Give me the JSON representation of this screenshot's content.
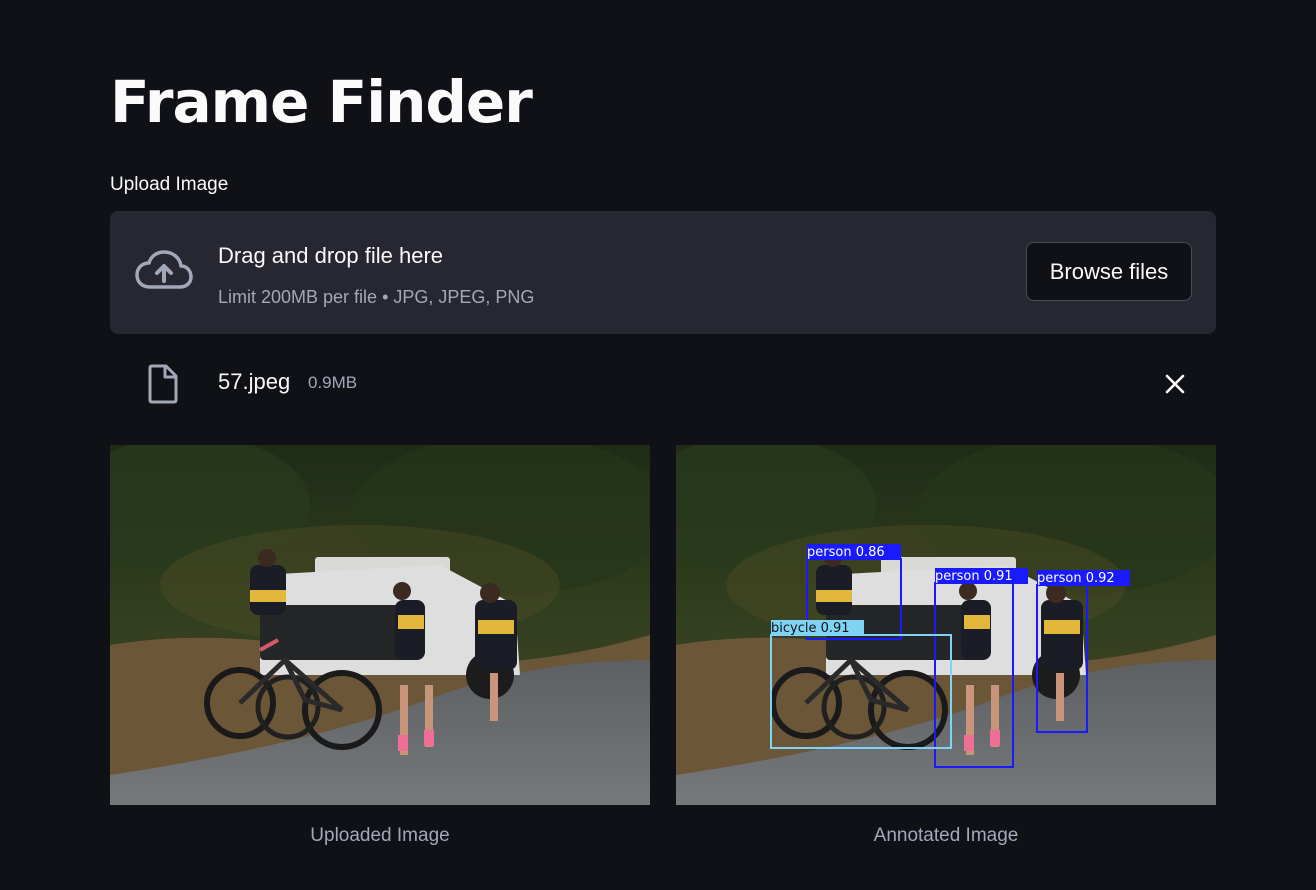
{
  "app": {
    "title": "Frame Finder"
  },
  "uploader": {
    "label": "Upload Image",
    "drop_text": "Drag and drop file here",
    "limit_text": "Limit 200MB per file • JPG, JPEG, PNG",
    "browse_label": "Browse files",
    "icon": "cloud-upload-icon"
  },
  "file": {
    "name": "57.jpeg",
    "size": "0.9MB",
    "icon": "file-icon",
    "remove_icon": "close-icon"
  },
  "images": {
    "uploaded_caption": "Uploaded Image",
    "annotated_caption": "Annotated Image"
  },
  "detections": [
    {
      "label": "person 0.86",
      "color": "#1a1aff"
    },
    {
      "label": "person 0.91",
      "color": "#1a1aff"
    },
    {
      "label": "person 0.92",
      "color": "#1a1aff"
    },
    {
      "label": "bicycle 0.91",
      "color": "#7fd3f5"
    }
  ],
  "colors": {
    "background": "#0f1116",
    "dropzone": "#262730",
    "muted_text": "#a3a8b8",
    "person_box": "#1a1aff",
    "bicycle_box": "#7fd3f5"
  }
}
